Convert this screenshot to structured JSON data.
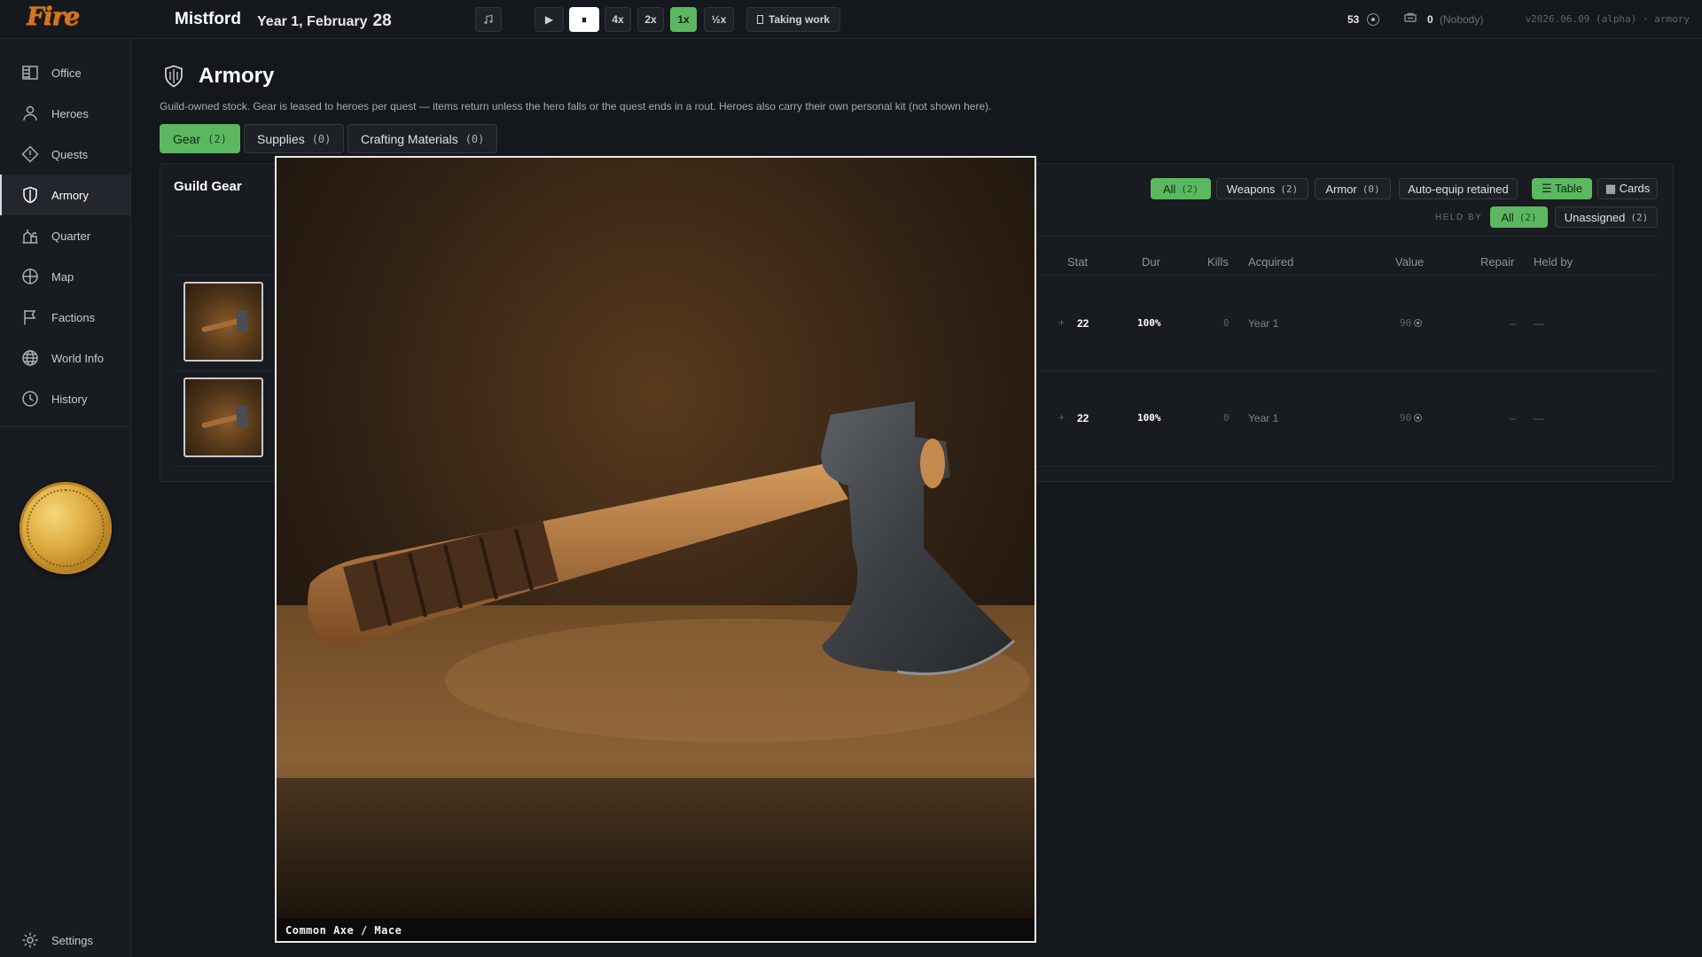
{
  "topbar": {
    "logo": "Fire",
    "town": "Mistford",
    "date": "Year 1, February",
    "day": "28",
    "music_icon": "music-note-icon",
    "speeds": {
      "play": "▶",
      "pause": "⏸",
      "x4": "4x",
      "x2": "2x",
      "x1": "1x",
      "half": "½x"
    },
    "work_status": "Taking work",
    "gold": "53",
    "assigned_count": "0",
    "assigned_label": "(Nobody)",
    "version": "v2026.06.09 (alpha) · armory"
  },
  "sidebar": {
    "items": [
      {
        "label": "Office",
        "icon": "office-icon"
      },
      {
        "label": "Heroes",
        "icon": "person-icon"
      },
      {
        "label": "Quests",
        "icon": "diamond-icon"
      },
      {
        "label": "Armory",
        "icon": "shield-icon"
      },
      {
        "label": "Quarter",
        "icon": "buildings-icon"
      },
      {
        "label": "Map",
        "icon": "crosshair-icon"
      },
      {
        "label": "Factions",
        "icon": "flag-icon"
      },
      {
        "label": "World Info",
        "icon": "globe-icon"
      },
      {
        "label": "History",
        "icon": "clock-icon"
      }
    ],
    "settings": "Settings",
    "active": "Armory"
  },
  "page": {
    "title": "Armory",
    "description": "Guild-owned stock. Gear is leased to heroes per quest — items return unless the hero falls or the quest ends in a rout. Heroes also carry their own personal kit (not shown here).",
    "tabs": [
      {
        "label": "Gear",
        "count": "(2)"
      },
      {
        "label": "Supplies",
        "count": "(0)"
      },
      {
        "label": "Crafting Materials",
        "count": "(0)"
      }
    ]
  },
  "gear_panel": {
    "title": "Guild Gear",
    "filters": {
      "all": {
        "label": "All",
        "count": "(2)"
      },
      "weapons": {
        "label": "Weapons",
        "count": "(2)"
      },
      "armor": {
        "label": "Armor",
        "count": "(0)"
      },
      "auto_equip": "Auto-equip retained",
      "table": "☰ Table",
      "cards": "▦ Cards"
    },
    "held_by_label": "HELD BY",
    "held_by": {
      "all": {
        "label": "All",
        "count": "(2)"
      },
      "unassigned": {
        "label": "Unassigned",
        "count": "(2)"
      }
    },
    "columns": [
      "Stat",
      "Dur",
      "Kills",
      "Acquired",
      "Value",
      "Repair",
      "Held by"
    ],
    "rows": [
      {
        "stat_icon": "+",
        "stat": "22",
        "dur": "100%",
        "kills": "0",
        "acquired": "Year 1",
        "value": "90",
        "repair": "–",
        "held_by": "—"
      },
      {
        "stat_icon": "+",
        "stat": "22",
        "dur": "100%",
        "kills": "0",
        "acquired": "Year 1",
        "value": "90",
        "repair": "–",
        "held_by": "—"
      }
    ]
  },
  "lightbox": {
    "caption": "Common Axe / Mace"
  },
  "colors": {
    "accent_green": "#5cb860",
    "background": "#14171b",
    "sidebar": "#181b1f"
  }
}
